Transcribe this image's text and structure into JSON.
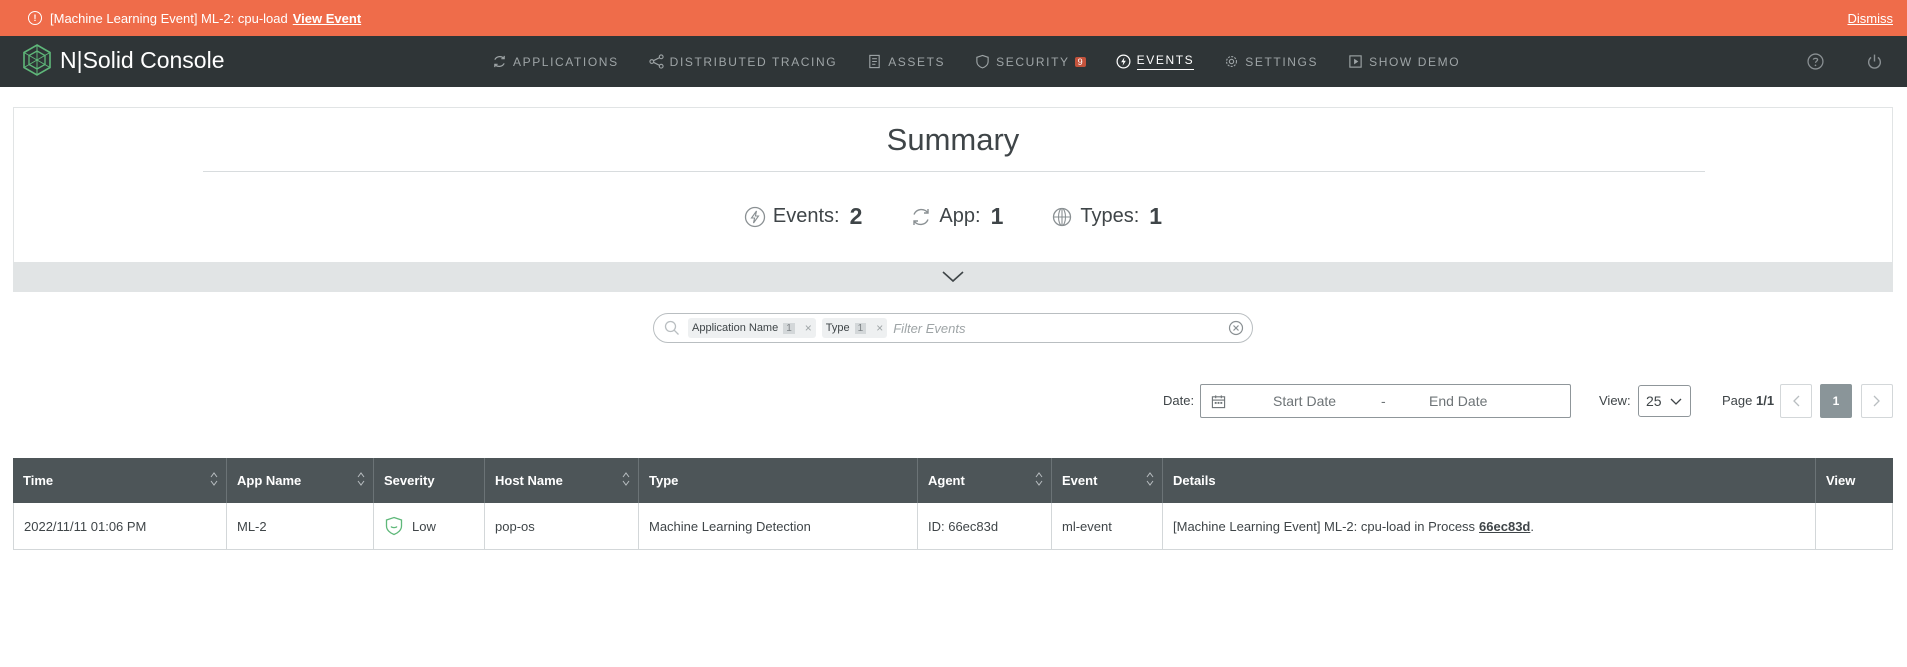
{
  "banner": {
    "message": "[Machine Learning Event] ML-2: cpu-load",
    "view_link": "View Event",
    "dismiss": "Dismiss",
    "color": "#ef6c4a"
  },
  "navbar": {
    "brand": "N|Solid Console",
    "items": [
      {
        "label": "APPLICATIONS",
        "icon": "refresh-icon"
      },
      {
        "label": "DISTRIBUTED TRACING",
        "icon": "share-icon"
      },
      {
        "label": "ASSETS",
        "icon": "document-icon"
      },
      {
        "label": "SECURITY",
        "icon": "shield-icon",
        "badge": "9"
      },
      {
        "label": "EVENTS",
        "icon": "lightning-icon",
        "active": true
      },
      {
        "label": "SETTINGS",
        "icon": "gear-icon"
      },
      {
        "label": "SHOW DEMO",
        "icon": "play-icon"
      }
    ],
    "right_icons": [
      "help-icon",
      "power-icon"
    ]
  },
  "summary": {
    "title": "Summary",
    "stats": [
      {
        "label": "Events:",
        "value": "2",
        "icon": "lightning-icon"
      },
      {
        "label": "App:",
        "value": "1",
        "icon": "refresh-icon"
      },
      {
        "label": "Types:",
        "value": "1",
        "icon": "globe-icon"
      }
    ]
  },
  "search": {
    "chips": [
      {
        "label": "Application Name",
        "count": "1"
      },
      {
        "label": "Type",
        "count": "1"
      }
    ],
    "placeholder": "Filter Events"
  },
  "controls": {
    "date_label": "Date:",
    "start_placeholder": "Start Date",
    "separator": "-",
    "end_placeholder": "End Date",
    "view_label": "View:",
    "view_value": "25",
    "page_prefix": "Page",
    "page_value": "1/1",
    "current_page": "1"
  },
  "table": {
    "columns": [
      "Time",
      "App Name",
      "Severity",
      "Host Name",
      "Type",
      "Agent",
      "Event",
      "Details",
      "View"
    ],
    "rows": [
      {
        "time": "2022/11/11 01:06 PM",
        "app_name": "ML-2",
        "severity": "Low",
        "host_name": "pop-os",
        "type": "Machine Learning Detection",
        "agent": "ID: 66ec83d",
        "event": "ml-event",
        "details_prefix": "[Machine Learning Event] ML-2: cpu-load in Process",
        "details_link": "66ec83d",
        "details_suffix": ".",
        "view": ""
      }
    ]
  }
}
